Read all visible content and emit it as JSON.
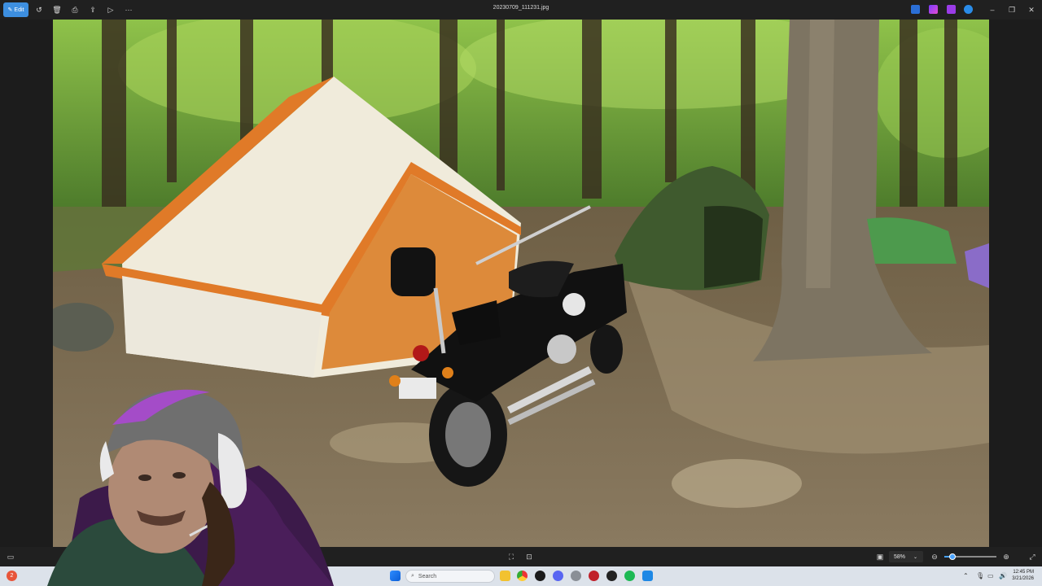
{
  "toolbar": {
    "edit_label": "Edit",
    "more_label": "···"
  },
  "window": {
    "title": "20230709_111231.jpg"
  },
  "viewer": {
    "zoom_value": "58%",
    "zoom_level": 0.15
  },
  "taskbar": {
    "search_placeholder": "Search",
    "notification_count": "2",
    "time": "12:45 PM",
    "date": "3/21/2026"
  },
  "colors": {
    "accent": "#3d8fe0",
    "toolbar_bg": "#202020",
    "taskbar_bg": "#dce2ea"
  }
}
